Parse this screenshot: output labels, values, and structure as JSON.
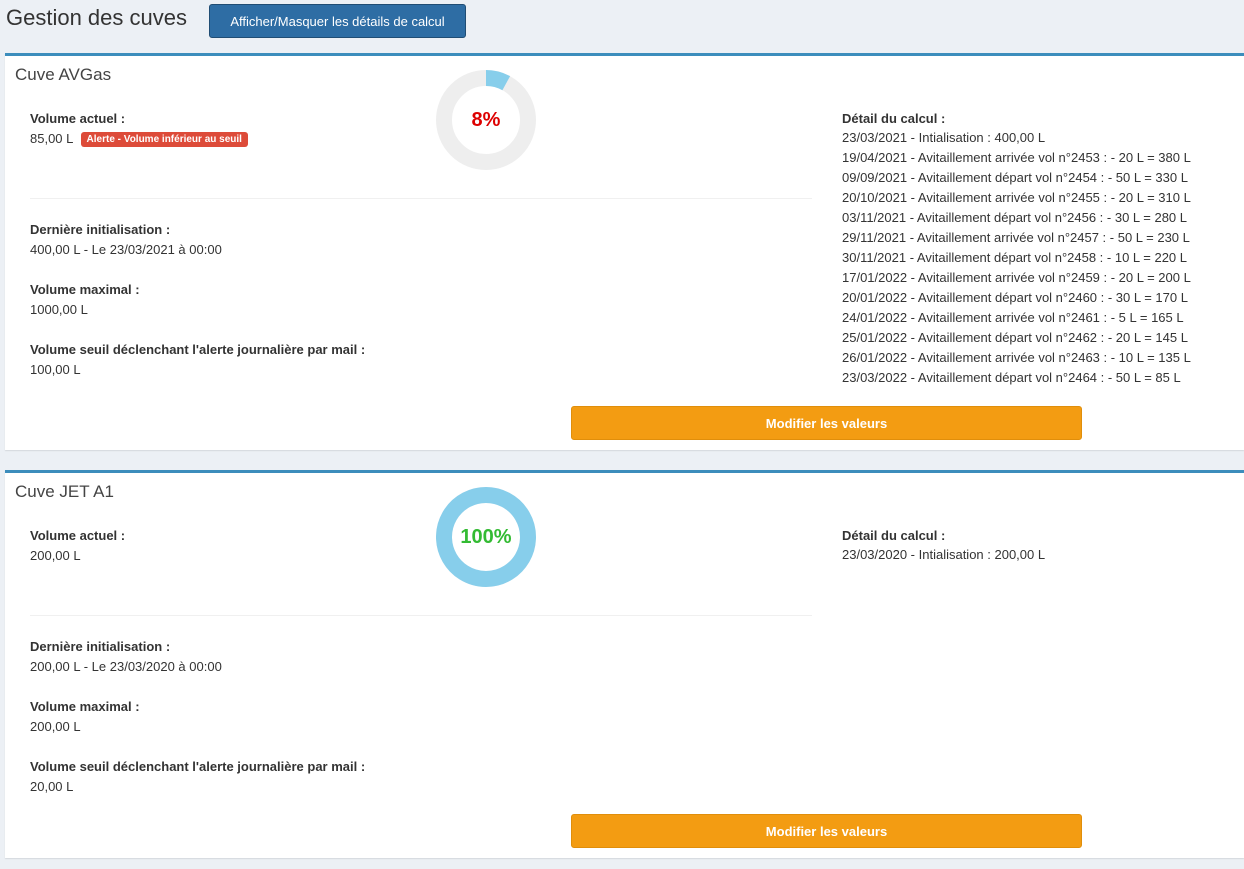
{
  "page": {
    "title": "Gestion des cuves",
    "toggle_details_label": "Afficher/Masquer les détails de calcul"
  },
  "colors": {
    "primary_button": "#2e6da4",
    "box_border": "#3c8dbc",
    "modify_button": "#f39c12",
    "alert_badge": "#dd4b39",
    "donut_fill": "#87ceeb",
    "donut_track": "#eeeeee",
    "pct_low": "#dd0000",
    "pct_full": "#33bb33"
  },
  "tanks": [
    {
      "name": "Cuve AVGas",
      "percent": 8,
      "percent_label": "8%",
      "current_volume_label": "Volume actuel :",
      "current_volume": "85,00 L",
      "alert_badge": "Alerte - Volume inférieur au seuil",
      "last_init_label": "Dernière initialisation :",
      "last_init": "400,00 L - Le 23/03/2021 à 00:00",
      "max_volume_label": "Volume maximal :",
      "max_volume": "1000,00 L",
      "threshold_label": "Volume seuil déclenchant l'alerte journalière par mail :",
      "threshold": "100,00 L",
      "detail_label": "Détail du calcul :",
      "details": [
        "23/03/2021 - Intialisation : 400,00 L",
        "19/04/2021 - Avitaillement arrivée vol n°2453 : - 20 L = 380 L",
        "09/09/2021 - Avitaillement départ vol n°2454 : - 50 L = 330 L",
        "20/10/2021 - Avitaillement arrivée vol n°2455 : - 20 L = 310 L",
        "03/11/2021 - Avitaillement départ vol n°2456 : - 30 L = 280 L",
        "29/11/2021 - Avitaillement arrivée vol n°2457 : - 50 L = 230 L",
        "30/11/2021 - Avitaillement départ vol n°2458 : - 10 L = 220 L",
        "17/01/2022 - Avitaillement arrivée vol n°2459 : - 20 L = 200 L",
        "20/01/2022 - Avitaillement départ vol n°2460 : - 30 L = 170 L",
        "24/01/2022 - Avitaillement arrivée vol n°2461 : - 5 L = 165 L",
        "25/01/2022 - Avitaillement départ vol n°2462 : - 20 L = 145 L",
        "26/01/2022 - Avitaillement arrivée vol n°2463 : - 10 L = 135 L",
        "23/03/2022 - Avitaillement départ vol n°2464 : - 50 L = 85 L"
      ],
      "modify_label": "Modifier les valeurs"
    },
    {
      "name": "Cuve JET A1",
      "percent": 100,
      "percent_label": "100%",
      "current_volume_label": "Volume actuel :",
      "current_volume": "200,00 L",
      "last_init_label": "Dernière initialisation :",
      "last_init": "200,00 L - Le 23/03/2020 à 00:00",
      "max_volume_label": "Volume maximal :",
      "max_volume": "200,00 L",
      "threshold_label": "Volume seuil déclenchant l'alerte journalière par mail :",
      "threshold": "20,00 L",
      "detail_label": "Détail du calcul :",
      "details": [
        "23/03/2020 - Intialisation : 200,00 L"
      ],
      "modify_label": "Modifier les valeurs"
    }
  ]
}
